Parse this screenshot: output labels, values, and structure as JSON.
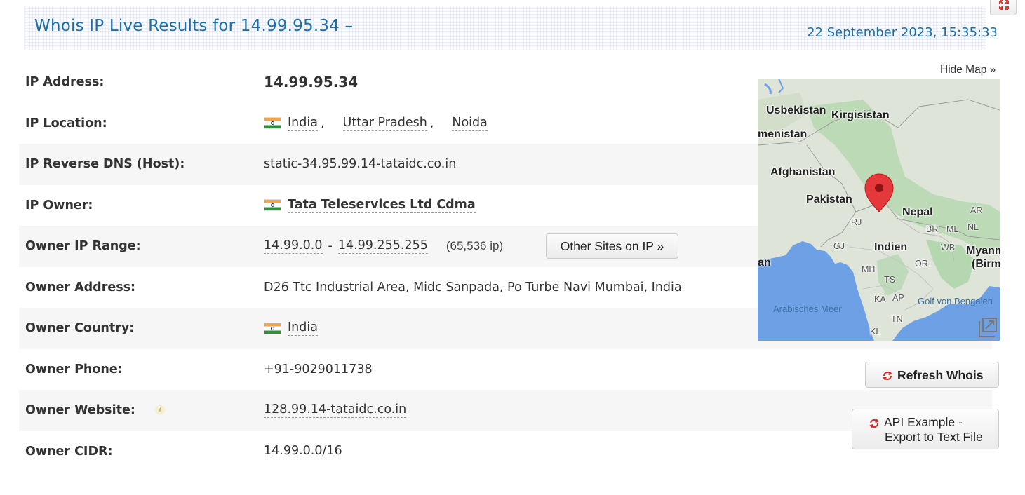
{
  "header": {
    "title": "Whois IP Live Results for 14.99.95.34 –",
    "datetime": "22 September 2023, 15:35:33"
  },
  "rows": [
    {
      "label": "IP Address:",
      "value": "14.99.95.34"
    },
    {
      "label": "IP Location:",
      "country": "India",
      "region": "Uttar Pradesh",
      "city": "Noida",
      "sep": ","
    },
    {
      "label": "IP Reverse DNS (Host):",
      "value": "static-34.95.99.14-tataidc.co.in"
    },
    {
      "label": "IP Owner:",
      "value": "Tata Teleservices Ltd Cdma"
    },
    {
      "label": "Owner IP Range:",
      "range_start": "14.99.0.0",
      "range_dash": "-",
      "range_end": "14.99.255.255",
      "count": "(65,536 ip)",
      "button": "Other Sites on IP »"
    },
    {
      "label": "Owner Address:",
      "value": "D26 Ttc Industrial Area, Midc Sanpada, Po Turbe Navi Mumbai, India"
    },
    {
      "label": "Owner Country:",
      "value": "India"
    },
    {
      "label": "Owner Phone:",
      "value": "+91-9029011738"
    },
    {
      "label": "Owner Website:",
      "value": "128.99.14-tataidc.co.in",
      "info_icon": "i"
    },
    {
      "label": "Owner CIDR:",
      "value": "14.99.0.0/16"
    }
  ],
  "map": {
    "hide_label": "Hide Map »",
    "countries": [
      "Usbekistan",
      "Kirgisistan",
      "menistan",
      "Afghanistan",
      "Pakistan",
      "Nepal",
      "Indien",
      "Myanm",
      "(Birm",
      "an"
    ],
    "states": [
      "RJ",
      "GJ",
      "MH",
      "TS",
      "KA",
      "AP",
      "TN",
      "KL",
      "OR",
      "WB",
      "BR",
      "ML",
      "NL",
      "AR"
    ],
    "seas": [
      "Arabisches Meer",
      "Golf von Bengalen"
    ],
    "colors": {
      "water": "#6ea0e6",
      "land": "#dfe4d9",
      "green": "#9fd3a4",
      "marker": "#e5383b"
    }
  },
  "buttons": {
    "refresh": "Refresh Whois",
    "api_line1": "API Example -",
    "api_line2": "Export to Text File"
  },
  "icons": {
    "refresh": "refresh-icon",
    "expand": "expand-icon",
    "flag": "india-flag-icon",
    "pin": "map-pin-icon",
    "fullscreen": "map-fullscreen-icon"
  }
}
